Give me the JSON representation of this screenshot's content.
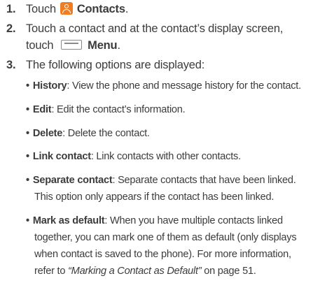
{
  "steps": [
    {
      "number": "1.",
      "text": "Touch",
      "bold": "Contacts",
      "end": "."
    },
    {
      "number": "2.",
      "line1": "Touch a contact and at the contact’s display screen,",
      "line2_pre": "touch",
      "line2_bold": "Menu",
      "line2_end": "."
    },
    {
      "number": "3.",
      "text": "The following options are displayed:"
    }
  ],
  "options": [
    {
      "term": "History",
      "desc": ": View the phone and message history for the contact."
    },
    {
      "term": "Edit",
      "desc": ": Edit the contact’s information."
    },
    {
      "term": "Delete",
      "desc": ": Delete the contact."
    },
    {
      "term": "Link contact",
      "desc": ": Link contacts with other contacts."
    },
    {
      "term": "Separate contact",
      "desc": ": Separate contacts that have been linked.",
      "cont": [
        "This option only appears if the contact has been linked."
      ]
    },
    {
      "term": "Mark as default",
      "desc": ": When you have multiple contacts linked",
      "cont": [
        "together, you can mark one of them as default (only displays",
        "when contact is saved to the phone). For more information,"
      ],
      "ref_pre": "refer to ",
      "ref_link": "“Marking a Contact as Default”",
      "ref_post": " on page 51."
    }
  ],
  "icons": {
    "contacts": "contacts-app-icon",
    "menu": "menu-key-icon"
  },
  "colors": {
    "contacts_icon": "#f07d22",
    "text": "#3c3c3c"
  }
}
